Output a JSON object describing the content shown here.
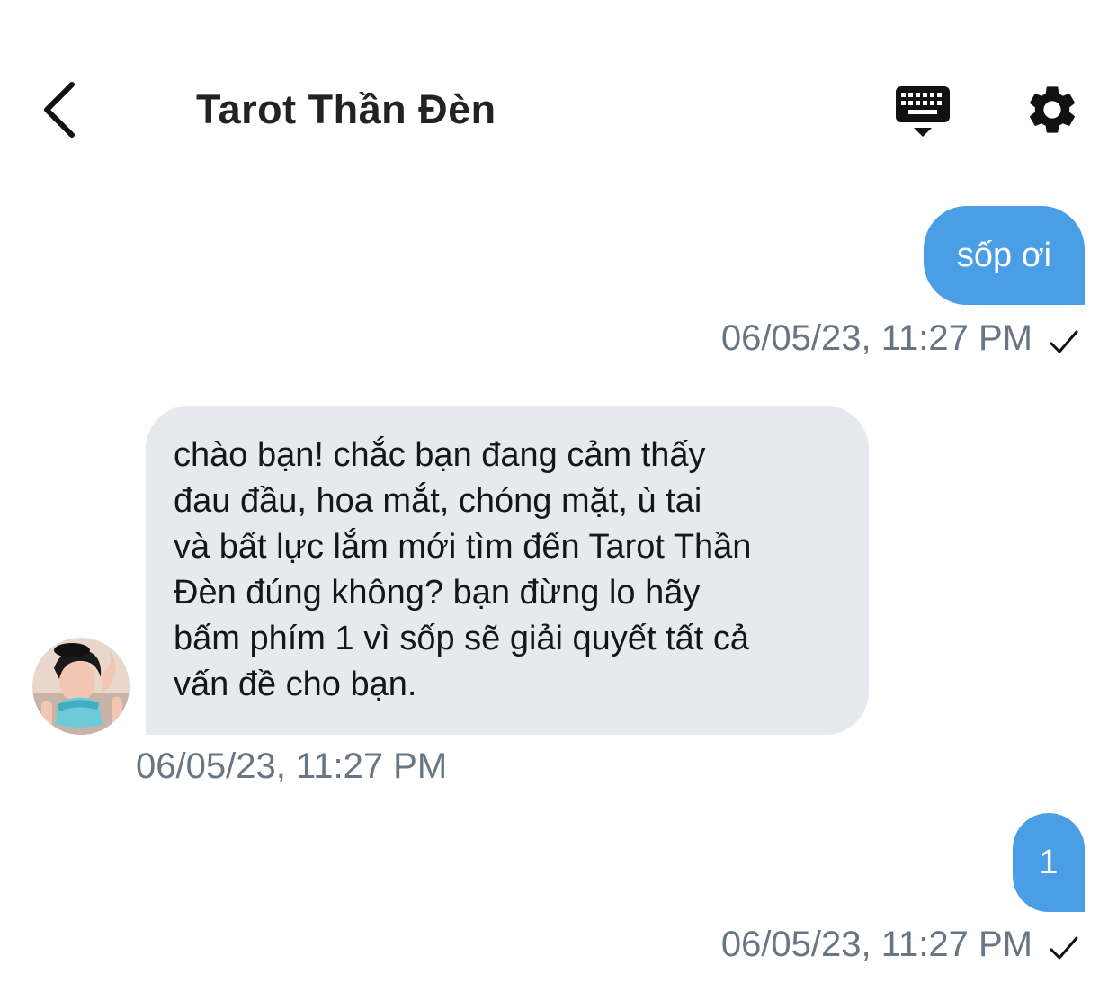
{
  "header": {
    "title": "Tarot Thần Đèn",
    "back_icon": "chevron-left-icon",
    "keyboard_icon": "keyboard-icon",
    "settings_icon": "gear-icon"
  },
  "messages": [
    {
      "direction": "outgoing",
      "text": "sốp ơi",
      "timestamp": "06/05/23, 11:27 PM",
      "status_icon": "checkmark-icon"
    },
    {
      "direction": "incoming",
      "lines": [
        "chào bạn! chắc bạn đang cảm thấy",
        "đau đầu, hoa mắt, chóng mặt, ù tai",
        "và bất lực lắm mới tìm đến Tarot Thần",
        "Đèn đúng không? bạn đừng lo hãy",
        "bấm phím 1 vì sốp sẽ giải quyết tất cả",
        "vấn đề cho bạn."
      ],
      "timestamp": "06/05/23, 11:27 PM",
      "avatar_icon": "avatar"
    },
    {
      "direction": "outgoing",
      "text": "1",
      "timestamp": "06/05/23, 11:27 PM",
      "status_icon": "checkmark-icon"
    }
  ],
  "colors": {
    "outgoing_bubble": "#4a9ee6",
    "incoming_bubble": "#e6e9ed",
    "timestamp": "#687684",
    "icon": "#111111"
  }
}
